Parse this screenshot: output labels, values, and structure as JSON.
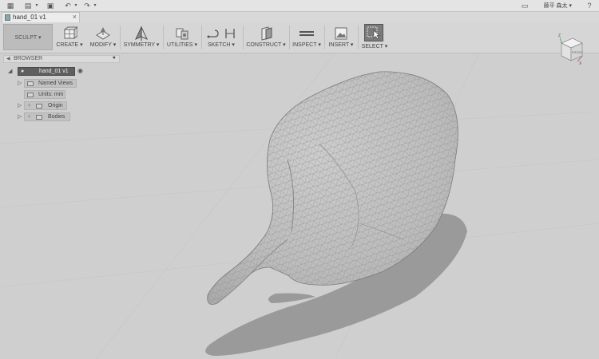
{
  "topbar": {
    "user_label": "藤平 森太 ▾"
  },
  "tab": {
    "title": "hand_01 v1",
    "close": "×"
  },
  "toolbar": {
    "workspace": "SCULPT ▾",
    "tools": [
      {
        "label": "CREATE ▾"
      },
      {
        "label": "MODIFY ▾"
      },
      {
        "label": "SYMMETRY ▾"
      },
      {
        "label": "UTILITIES ▾"
      },
      {
        "label": "SKETCH ▾"
      },
      {
        "label": "CONSTRUCT ▾"
      },
      {
        "label": "INSPECT ▾"
      },
      {
        "label": "INSERT ▾"
      },
      {
        "label": "SELECT ▾"
      }
    ]
  },
  "browser": {
    "title": "BROWSER",
    "root": "hand_01 v1",
    "items": [
      {
        "label": "Named Views"
      },
      {
        "label": "Units: mm"
      },
      {
        "label": "Origin"
      },
      {
        "label": "Bodies"
      }
    ]
  },
  "viewcube": {
    "front": "FRONT",
    "axis_z": "Z",
    "axis_x": "X"
  },
  "colors": {
    "background": "#cfcfcf",
    "mesh": "#b9b9b9",
    "shadow": "#8c8c8c",
    "toolbar": "#d6d6d6"
  }
}
